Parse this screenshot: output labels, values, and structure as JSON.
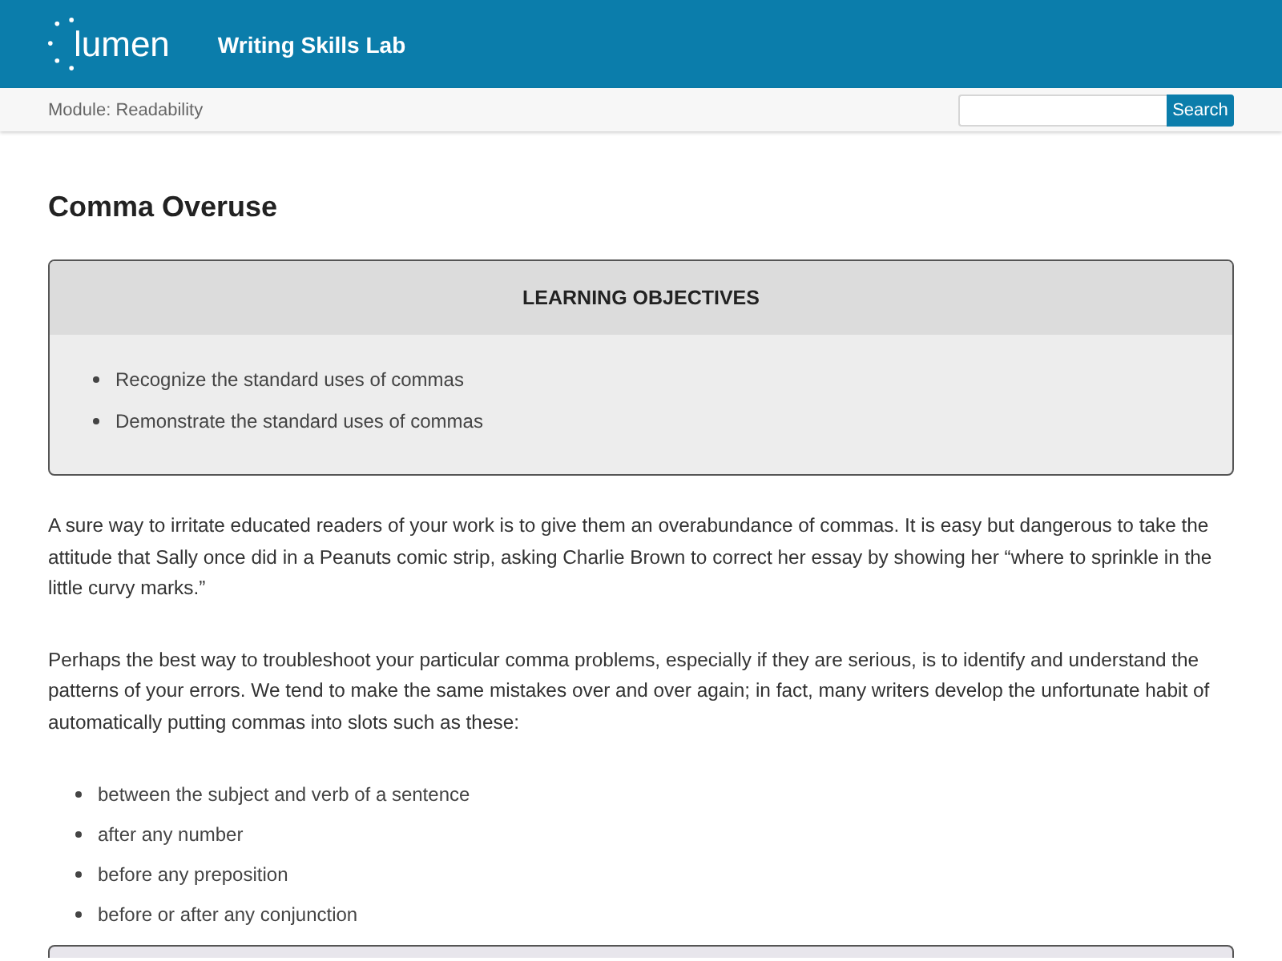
{
  "header": {
    "logo": "lumen",
    "title": "Writing Skills Lab"
  },
  "module_bar": {
    "module": "Module: Readability",
    "search_button": "Search"
  },
  "article": {
    "title": "Comma Overuse",
    "objectives": {
      "heading": "LEARNING OBJECTIVES",
      "items": [
        "Recognize the standard uses of commas",
        "Demonstrate the standard uses of commas"
      ]
    },
    "paragraphs": [
      "A sure way to irritate educated readers of your work is to give them an overabundance of commas. It is easy but dangerous to take the attitude that Sally once did in a Peanuts comic strip, asking Charlie Brown to correct her essay by showing her “where to sprinkle in the little curvy marks.”",
      "Perhaps the best way to troubleshoot your particular comma problems, especially if they are serious, is to identify and understand the patterns of your errors. We tend to make the same mistakes over and over again; in fact, many writers develop the unfortunate habit of automatically putting commas into slots such as these:"
    ],
    "list": [
      "between the subject and verb of a sentence",
      "after any number",
      "before any preposition",
      "before or after any conjunction"
    ]
  }
}
